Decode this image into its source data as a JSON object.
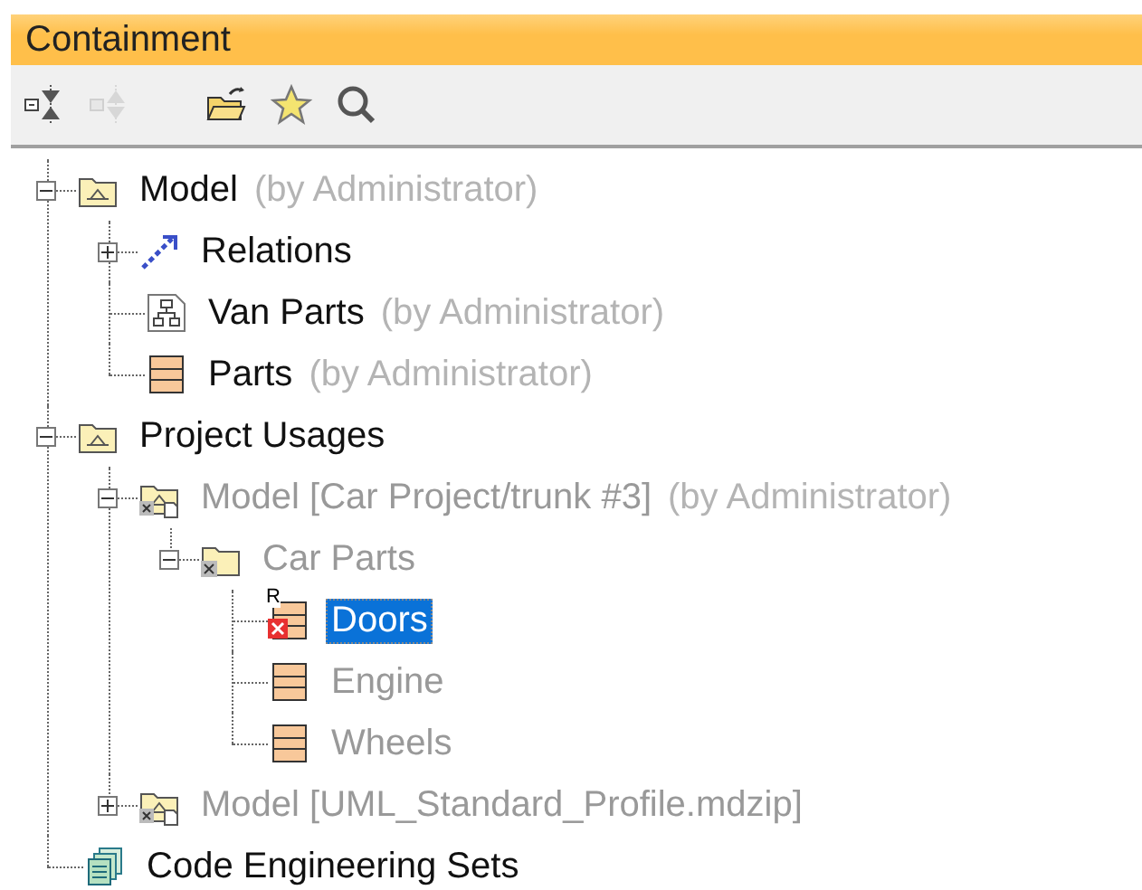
{
  "panel": {
    "title": "Containment"
  },
  "toolbar": [
    {
      "kind": "collapse",
      "disabled": false
    },
    {
      "kind": "expand",
      "disabled": true
    },
    {
      "kind": "open",
      "disabled": false
    },
    {
      "kind": "star",
      "disabled": false
    },
    {
      "kind": "search",
      "disabled": false
    }
  ],
  "tree": [
    {
      "label": "Model",
      "note": "(by Administrator)",
      "kind": "package",
      "expanded": true,
      "dimmed": false,
      "selected": false,
      "broken": false,
      "children": [
        {
          "label": "Relations",
          "kind": "relations",
          "expanded": false,
          "dimmed": false,
          "selected": false,
          "broken": false
        },
        {
          "label": "Van Parts",
          "note": "(by Administrator)",
          "kind": "diagram",
          "dimmed": false,
          "selected": false,
          "broken": false
        },
        {
          "label": "Parts",
          "note": "(by Administrator)",
          "kind": "block",
          "dimmed": false,
          "selected": false,
          "broken": false
        }
      ]
    },
    {
      "label": "Project Usages",
      "kind": "package",
      "expanded": true,
      "dimmed": false,
      "selected": false,
      "broken": false,
      "children": [
        {
          "label": "Model [Car Project/trunk #3]",
          "note": "(by Administrator)",
          "kind": "usedmodel",
          "expanded": true,
          "dimmed": true,
          "selected": false,
          "broken": false,
          "children": [
            {
              "label": "Car Parts",
              "kind": "usedpackage",
              "expanded": true,
              "dimmed": true,
              "selected": false,
              "broken": false,
              "children": [
                {
                  "label": "Doors",
                  "badge": "R",
                  "kind": "block",
                  "dimmed": false,
                  "selected": true,
                  "broken": true
                },
                {
                  "label": "Engine",
                  "kind": "block",
                  "dimmed": true,
                  "selected": false,
                  "broken": false
                },
                {
                  "label": "Wheels",
                  "kind": "block",
                  "dimmed": true,
                  "selected": false,
                  "broken": false
                }
              ]
            }
          ]
        },
        {
          "label": "Model [UML_Standard_Profile.mdzip]",
          "kind": "usedmodel",
          "expanded": false,
          "dimmed": true,
          "selected": false,
          "broken": false
        }
      ]
    },
    {
      "label": "Code Engineering Sets",
      "kind": "codesets",
      "dimmed": false,
      "selected": false,
      "broken": false
    }
  ]
}
